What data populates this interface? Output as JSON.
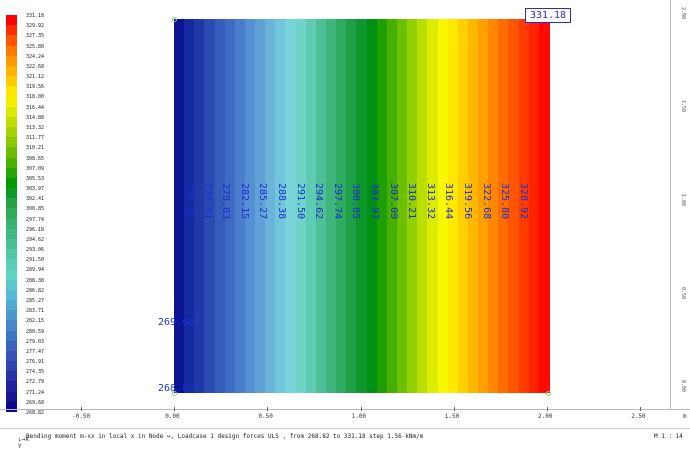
{
  "legend": {
    "colors": [
      "#ff0000",
      "#ff2d00",
      "#ff5500",
      "#ff7a00",
      "#ff9900",
      "#ffb300",
      "#ffcc00",
      "#ffe600",
      "#f4f000",
      "#dde800",
      "#c0dd00",
      "#a6d200",
      "#8ac800",
      "#6cbc00",
      "#4cb000",
      "#26a400",
      "#009900",
      "#0d9a25",
      "#24a244",
      "#32ab5d",
      "#3ab272",
      "#40b884",
      "#46c095",
      "#4fc8a6",
      "#58d0b6",
      "#5ed4c4",
      "#5bc8cf",
      "#55bad3",
      "#4fa9d3",
      "#4a98cf",
      "#4587cb",
      "#3f75c5",
      "#3a64bf",
      "#3453b8",
      "#2e42b0",
      "#2732a8",
      "#1f22a0",
      "#171498",
      "#0e0890"
    ],
    "labels": [
      "331.18",
      "329.92",
      "327.35",
      "325.80",
      "324.24",
      "322.68",
      "321.12",
      "319.56",
      "318.00",
      "316.44",
      "314.88",
      "313.32",
      "311.77",
      "310.21",
      "308.65",
      "307.09",
      "305.53",
      "303.97",
      "302.41",
      "300.85",
      "297.74",
      "296.18",
      "294.62",
      "293.06",
      "291.50",
      "289.94",
      "288.38",
      "286.82",
      "285.27",
      "283.71",
      "282.15",
      "280.59",
      "279.03",
      "277.47",
      "276.91",
      "274.35",
      "272.79",
      "271.24",
      "269.68",
      "268.82"
    ]
  },
  "plot": {
    "band_colors": [
      "#0c1494",
      "#142aa0",
      "#1f3aa8",
      "#2b4bb2",
      "#355cbb",
      "#3e6bc3",
      "#4a7dcb",
      "#5590d2",
      "#60a2d6",
      "#6ab4da",
      "#72c6dc",
      "#78d4d8",
      "#6fd4c8",
      "#5fcbb2",
      "#4fbf97",
      "#3fb47c",
      "#2faa61",
      "#1fa046",
      "#0f962c",
      "#009014",
      "#1fa000",
      "#45b000",
      "#6cc000",
      "#93d000",
      "#bade00",
      "#dcec00",
      "#f8f800",
      "#ffe800",
      "#ffd000",
      "#ffb800",
      "#ff9f00",
      "#ff8600",
      "#ff6d00",
      "#ff5400",
      "#ff3b00",
      "#ff2200",
      "#ff0a00"
    ],
    "contour_labels": [
      "275.92",
      "278.91",
      "279.03",
      "282.15",
      "285.27",
      "288.38",
      "291.50",
      "294.62",
      "297.74",
      "300.85",
      "303.97",
      "307.09",
      "310.21",
      "313.32",
      "316.44",
      "319.56",
      "322.68",
      "325.80",
      "328.92"
    ],
    "left_label_1": "269.68",
    "left_label_2": "268.82",
    "max_value": "331.18"
  },
  "axes": {
    "x_ticks": [
      "-0.50",
      "0.00",
      "0.50",
      "1.00",
      "1.50",
      "2.00",
      "2.50"
    ],
    "x_unit": "m",
    "y_ticks": [
      "0.00",
      "0.50",
      "1.00",
      "1.50",
      "2.00"
    ]
  },
  "status": {
    "text": "Bending moment m-xx in local x in Node    ↔, Loadcase 1  design forces ULS   , from 268.82 to 331.18 step 1.56 kNm/m",
    "scale": "M 1 : 14",
    "axis_icon_line1": "↓→X",
    "axis_icon_line2": "Y"
  }
}
